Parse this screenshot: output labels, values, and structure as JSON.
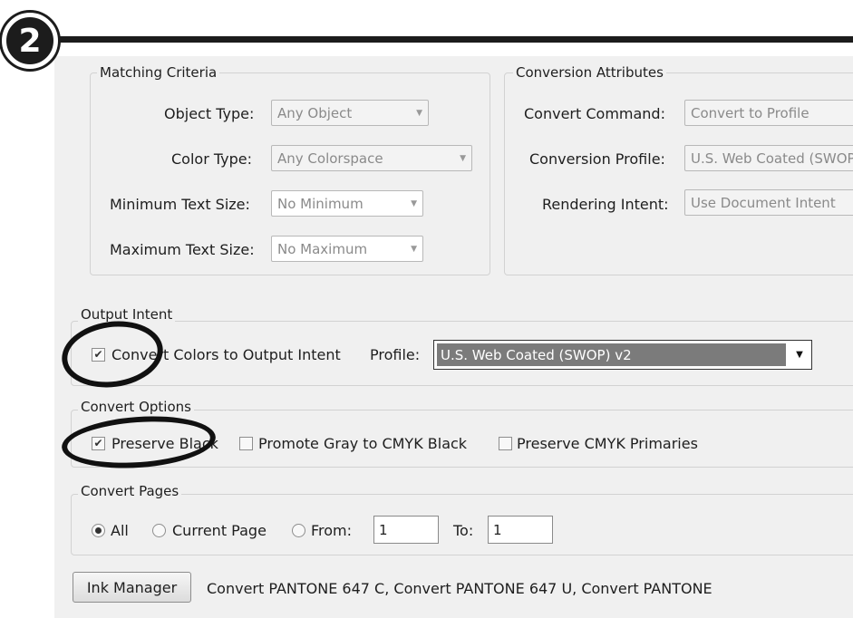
{
  "step_number": "2",
  "matching_criteria": {
    "title": "Matching Criteria",
    "object_type": {
      "label": "Object Type:",
      "value": "Any Object"
    },
    "color_type": {
      "label": "Color Type:",
      "value": "Any Colorspace"
    },
    "min_text_size": {
      "label": "Minimum Text Size:",
      "value": "No Minimum"
    },
    "max_text_size": {
      "label": "Maximum Text Size:",
      "value": "No Maximum"
    }
  },
  "conversion_attributes": {
    "title": "Conversion Attributes",
    "convert_command": {
      "label": "Convert Command:",
      "value": "Convert to Profile"
    },
    "conversion_profile": {
      "label": "Conversion Profile:",
      "value": "U.S. Web Coated (SWOP"
    },
    "rendering_intent": {
      "label": "Rendering Intent:",
      "value": "Use Document Intent"
    }
  },
  "output_intent": {
    "title": "Output Intent",
    "convert_checkbox_label": "Convert Colors to Output Intent",
    "convert_checked": true,
    "profile_label": "Profile:",
    "profile_value": "U.S. Web Coated (SWOP) v2"
  },
  "convert_options": {
    "title": "Convert Options",
    "preserve_black": {
      "label": "Preserve Black",
      "checked": true
    },
    "promote_gray": {
      "label": "Promote Gray to CMYK Black",
      "checked": false
    },
    "preserve_cmyk": {
      "label": "Preserve CMYK Primaries",
      "checked": false
    }
  },
  "convert_pages": {
    "title": "Convert Pages",
    "all_label": "All",
    "current_page_label": "Current Page",
    "from_label": "From:",
    "from_value": "1",
    "to_label": "To:",
    "to_value": "1",
    "selected": "All"
  },
  "ink_manager": {
    "button_label": "Ink Manager",
    "summary": "Convert PANTONE 647 C, Convert PANTONE 647 U, Convert PANTONE"
  },
  "icons": {
    "checkmark": "check-icon",
    "dropdown": "chevron-down-icon"
  },
  "colors": {
    "panel": "#f0f0f0",
    "highlight": "#7b7b7b",
    "annotation": "#111111"
  }
}
